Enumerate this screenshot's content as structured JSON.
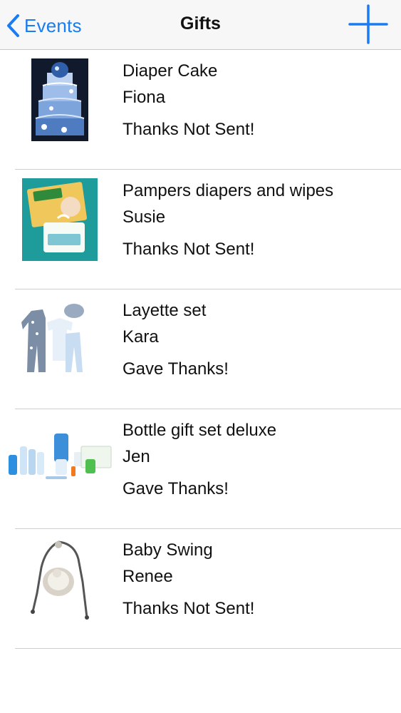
{
  "nav": {
    "back_label": "Events",
    "title": "Gifts",
    "back_icon": "chevron-left-icon",
    "add_icon": "plus-icon",
    "accent_color": "#1a7cf2"
  },
  "gifts": [
    {
      "name": "Diaper Cake",
      "from": "Fiona",
      "status": "Thanks Not Sent!",
      "image": "diaper-cake-photo"
    },
    {
      "name": "Pampers diapers and wipes",
      "from": "Susie",
      "status": "Thanks Not Sent!",
      "image": "pampers-photo"
    },
    {
      "name": "Layette set",
      "from": "Kara",
      "status": "Gave Thanks!",
      "image": "layette-photo"
    },
    {
      "name": "Bottle gift set deluxe",
      "from": "Jen",
      "status": "Gave Thanks!",
      "image": "bottle-set-photo"
    },
    {
      "name": "Baby Swing",
      "from": "Renee",
      "status": "Thanks Not Sent!",
      "image": "baby-swing-photo"
    }
  ]
}
